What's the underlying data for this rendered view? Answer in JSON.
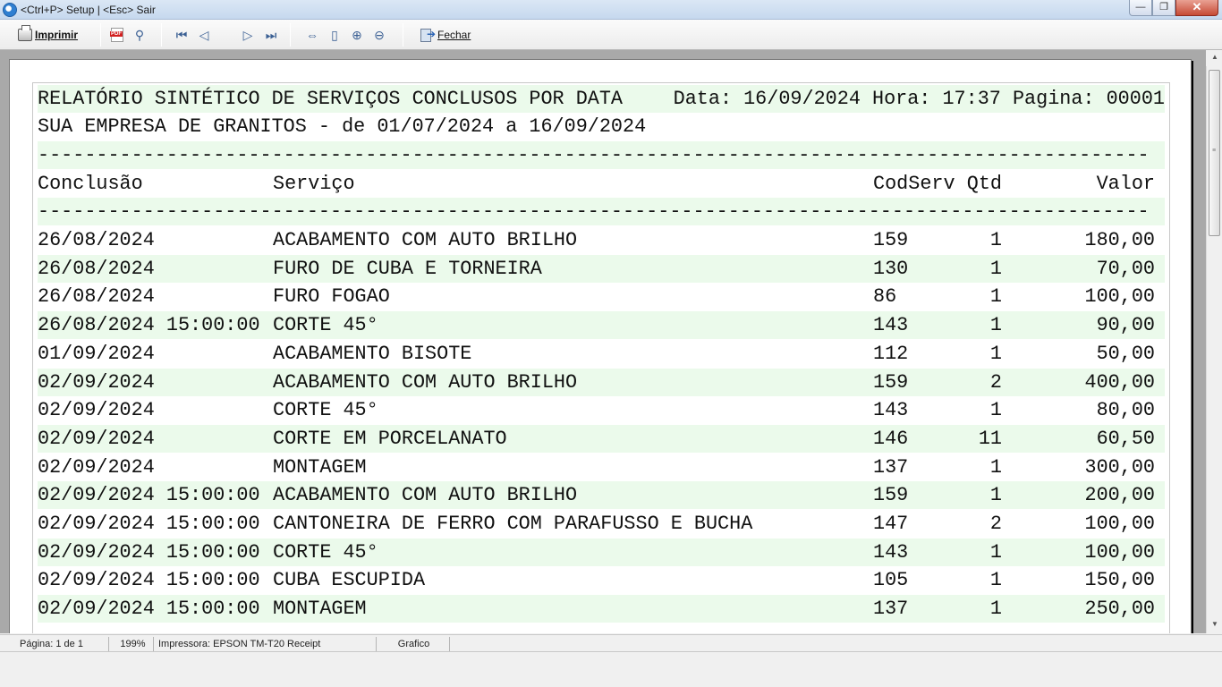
{
  "window": {
    "title": "<Ctrl+P> Setup | <Esc> Sair",
    "minimize": "—",
    "maximize": "❐",
    "close": "✕"
  },
  "toolbar": {
    "print_label": "Imprimir",
    "close_label": "Fechar",
    "icons": [
      "printer-icon",
      "pdf-icon",
      "find-icon",
      "first-page-icon",
      "prev-page-icon",
      "next-page-icon",
      "last-page-icon",
      "page-width-icon",
      "whole-page-icon",
      "zoom-in-icon",
      "zoom-out-icon",
      "exit-icon"
    ]
  },
  "report": {
    "title": "RELATÓRIO SINTÉTICO DE SERVIÇOS CONCLUSOS POR DATA",
    "date_info": "Data: 16/09/2024 Hora: 17:37 Pagina: 00001",
    "subtitle": "SUA EMPRESA DE GRANITOS - de 01/07/2024 a 16/09/2024",
    "separator": "-----------------------------------------------------------------------------------------------",
    "headers": {
      "conclusao": "Conclusão",
      "servico": "Serviço",
      "codserv": "CodServ",
      "qtd": "Qtd",
      "valor": "Valor"
    },
    "rows": [
      {
        "conclusao": "26/08/2024",
        "servico": "ACABAMENTO COM AUTO BRILHO",
        "codserv": "159",
        "qtd": "1",
        "valor": "180,00"
      },
      {
        "conclusao": "26/08/2024",
        "servico": "FURO DE CUBA E TORNEIRA",
        "codserv": "130",
        "qtd": "1",
        "valor": "70,00"
      },
      {
        "conclusao": "26/08/2024",
        "servico": "FURO FOGAO",
        "codserv": "86",
        "qtd": "1",
        "valor": "100,00"
      },
      {
        "conclusao": "26/08/2024 15:00:00",
        "servico": "CORTE 45°",
        "codserv": "143",
        "qtd": "1",
        "valor": "90,00"
      },
      {
        "conclusao": "01/09/2024",
        "servico": "ACABAMENTO BISOTE",
        "codserv": "112",
        "qtd": "1",
        "valor": "50,00"
      },
      {
        "conclusao": "02/09/2024",
        "servico": "ACABAMENTO COM AUTO BRILHO",
        "codserv": "159",
        "qtd": "2",
        "valor": "400,00"
      },
      {
        "conclusao": "02/09/2024",
        "servico": "CORTE 45°",
        "codserv": "143",
        "qtd": "1",
        "valor": "80,00"
      },
      {
        "conclusao": "02/09/2024",
        "servico": "CORTE EM PORCELANATO",
        "codserv": "146",
        "qtd": "11",
        "valor": "60,50"
      },
      {
        "conclusao": "02/09/2024",
        "servico": "MONTAGEM",
        "codserv": "137",
        "qtd": "1",
        "valor": "300,00"
      },
      {
        "conclusao": "02/09/2024 15:00:00",
        "servico": "ACABAMENTO COM AUTO BRILHO",
        "codserv": "159",
        "qtd": "1",
        "valor": "200,00"
      },
      {
        "conclusao": "02/09/2024 15:00:00",
        "servico": "CANTONEIRA DE FERRO COM PARAFUSSO E BUCHA",
        "codserv": "147",
        "qtd": "2",
        "valor": "100,00"
      },
      {
        "conclusao": "02/09/2024 15:00:00",
        "servico": "CORTE 45°",
        "codserv": "143",
        "qtd": "1",
        "valor": "100,00"
      },
      {
        "conclusao": "02/09/2024 15:00:00",
        "servico": "CUBA ESCUPIDA",
        "codserv": "105",
        "qtd": "1",
        "valor": "150,00"
      },
      {
        "conclusao": "02/09/2024 15:00:00",
        "servico": "MONTAGEM",
        "codserv": "137",
        "qtd": "1",
        "valor": "250,00"
      }
    ]
  },
  "status": {
    "page": "Página: 1 de 1",
    "zoom": "199%",
    "printer": "Impressora: EPSON TM-T20 Receipt",
    "mode": "Grafico"
  }
}
